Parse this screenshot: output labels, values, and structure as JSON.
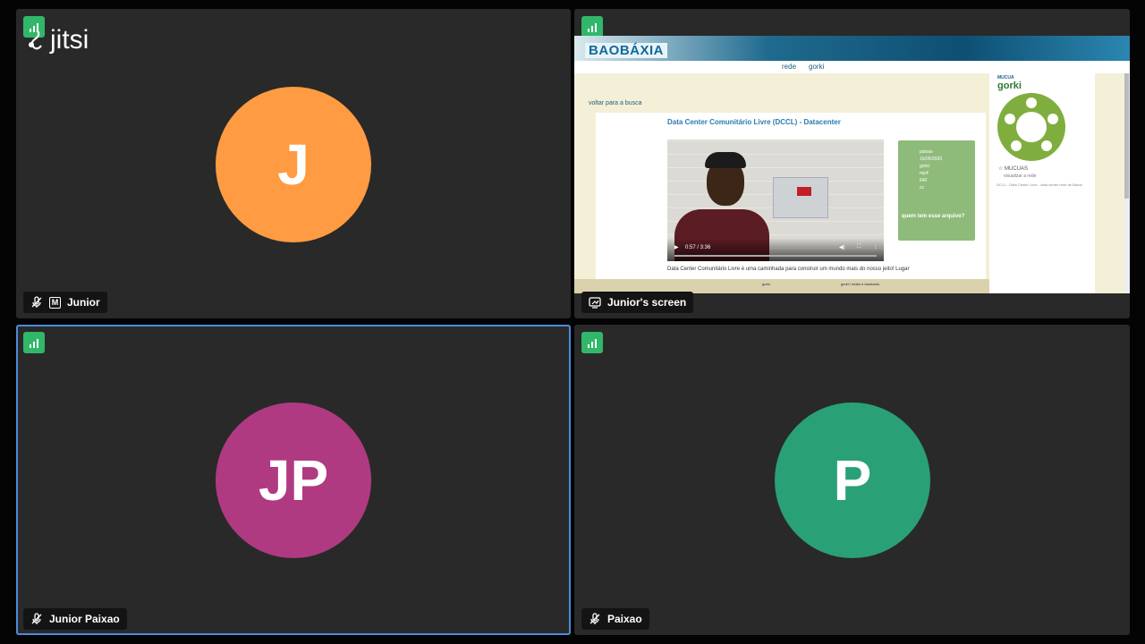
{
  "app": {
    "logo_text": "jitsi"
  },
  "tiles": [
    {
      "name": "Junior",
      "initials": "J",
      "color": "#ff9b42",
      "muted": true,
      "moderator": true,
      "moderator_badge": "M"
    },
    {
      "name": "Junior's screen",
      "type": "screen-share"
    },
    {
      "name": "Junior Paixao",
      "initials": "JP",
      "color": "#b03a82",
      "muted": true,
      "active_speaker": true
    },
    {
      "name": "Paixao",
      "initials": "P",
      "color": "#2aa076",
      "muted": true
    }
  ],
  "shared_screen": {
    "site_logo": "BAOBÁXIA",
    "nav": {
      "rede": "rede",
      "mucua": "gorki"
    },
    "back_link": "voltar para a busca",
    "page_title": "Data Center Comunitário Livre (DCCL) - Datacenter",
    "video": {
      "time": "0:57 / 3:36"
    },
    "meta": {
      "items": [
        "paixao",
        "16/05/2020",
        "gorki",
        "mp4",
        "640",
        "cc"
      ],
      "question": "quem tem esse arquivo?"
    },
    "description": "Data Center Comunitário Livre é uma caminhada para construir um mundo mais do nosso jeito! Lugar",
    "footer": {
      "left": "gorki",
      "right": "gorki / redes e baobaxia"
    },
    "sidebar": {
      "label": "MUCUA",
      "name": "gorki",
      "mucuas": "☆ MUCUAS",
      "view": "visualizar a rede",
      "note": "DCCL - Data Center Livre - data center rede de Baixio"
    }
  }
}
